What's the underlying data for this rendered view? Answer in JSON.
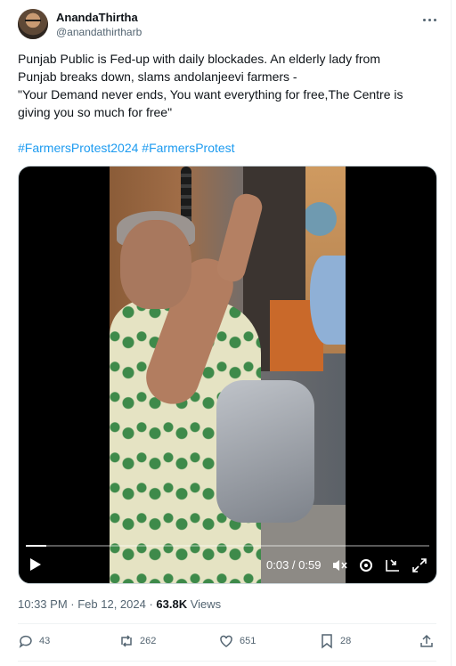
{
  "author": {
    "display_name": "AnandaThirtha",
    "handle": "@anandathirtharb"
  },
  "post": {
    "lines": [
      "Punjab Public is Fed-up with daily blockades. An elderly lady from",
      "Punjab breaks down, slams andolanjeevi farmers -",
      "\"Your Demand never ends, You want everything for free,The Centre is",
      "giving you so much for free\""
    ],
    "hashtags": [
      "#FarmersProtest2024",
      "#FarmersProtest"
    ]
  },
  "video": {
    "elapsed": "0:03",
    "separator": " / ",
    "duration": "0:59",
    "progress_fraction": 0.05,
    "icons": [
      "play-icon",
      "mute-icon",
      "settings-icon",
      "pip-icon",
      "fullscreen-icon"
    ]
  },
  "meta": {
    "time": "10:33 PM",
    "dot": " · ",
    "date": "Feb 12, 2024",
    "dot2": " · ",
    "views": "63.8K",
    "views_label": " Views"
  },
  "actions": {
    "replies": "43",
    "reposts": "262",
    "likes": "651",
    "bookmarks": "28"
  },
  "colors": {
    "accent": "#1d9bf0",
    "secondary_text": "#536471",
    "primary_text": "#0f1419"
  }
}
